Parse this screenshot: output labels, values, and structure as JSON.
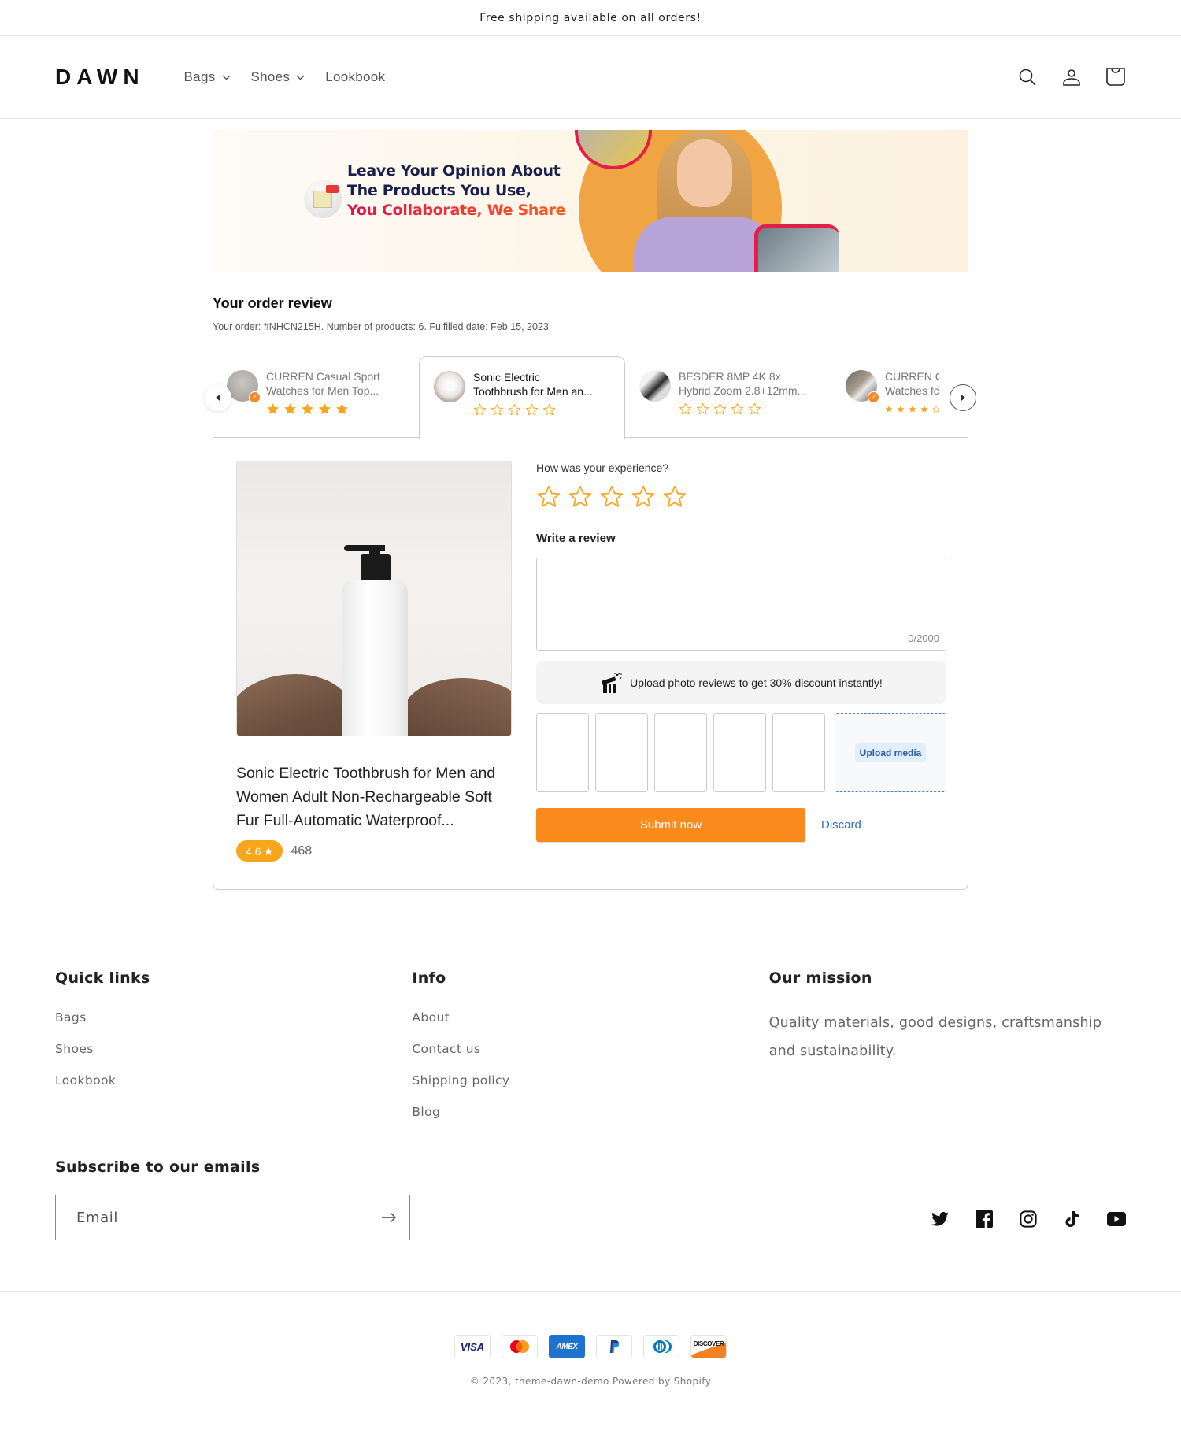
{
  "announcement": "Free shipping available on all orders!",
  "header": {
    "logo": "DAWN",
    "nav": [
      {
        "label": "Bags",
        "has_dropdown": true
      },
      {
        "label": "Shoes",
        "has_dropdown": true
      },
      {
        "label": "Lookbook",
        "has_dropdown": false
      }
    ],
    "icons": [
      "search-icon",
      "account-icon",
      "cart-icon"
    ]
  },
  "banner": {
    "line1": "Leave Your Opinion About",
    "line2": "The Products You Use,",
    "line3": "You Collaborate, We Share"
  },
  "review": {
    "title": "Your order review",
    "subtitle": "Your order: #NHCN215H. Number of products: 6. Fulfilled date: Feb 15, 2023",
    "products": [
      {
        "name_line1": "CURREN Casual Sport",
        "name_line2": "Watches for Men Top...",
        "rating": 5,
        "reviewed": true,
        "active": false
      },
      {
        "name_line1": "Sonic Electric",
        "name_line2": "Toothbrush for Men an...",
        "rating": 0,
        "reviewed": false,
        "active": true
      },
      {
        "name_line1": "BESDER 8MP 4K 8x",
        "name_line2": "Hybrid Zoom 2.8+12mm...",
        "rating": 0,
        "reviewed": false,
        "active": false
      },
      {
        "name_line1": "CURREN C",
        "name_line2": "Watches fc",
        "rating": 4,
        "reviewed": true,
        "active": false
      }
    ],
    "selected_product": {
      "title": "Sonic Electric Toothbrush for Men and Women Adult Non-Rechargeable Soft Fur Full-Automatic Waterproof...",
      "rating": "4.6",
      "review_count": "468"
    },
    "form": {
      "experience_label": "How was your experience?",
      "star_rating": 0,
      "star_max": 5,
      "write_label": "Write a review",
      "review_text": "",
      "char_count": "0/2000",
      "promo_text": "Upload photo reviews to get 30% discount instantly!",
      "media_slots": 5,
      "upload_label": "Upload media",
      "submit_label": "Submit now",
      "discard_label": "Discard"
    }
  },
  "footer": {
    "quick_links": {
      "heading": "Quick links",
      "links": [
        "Bags",
        "Shoes",
        "Lookbook"
      ]
    },
    "info": {
      "heading": "Info",
      "links": [
        "About",
        "Contact us",
        "Shipping policy",
        "Blog"
      ]
    },
    "mission": {
      "heading": "Our mission",
      "text": "Quality materials, good designs, craftsmanship and sustainability."
    },
    "subscribe": {
      "heading": "Subscribe to our emails",
      "placeholder": "Email"
    },
    "socials": [
      "twitter-icon",
      "facebook-icon",
      "instagram-icon",
      "tiktok-icon",
      "youtube-icon"
    ],
    "payments": [
      "VISA",
      "Mastercard",
      "AMEX",
      "PayPal",
      "Diners Club",
      "DISCOVER"
    ],
    "copyright": "© 2023, theme-dawn-demo Powered by Shopify"
  },
  "colors": {
    "accent_orange": "#fb8a1d",
    "star": "#f7a51b",
    "link_blue": "#2a6fd1"
  }
}
